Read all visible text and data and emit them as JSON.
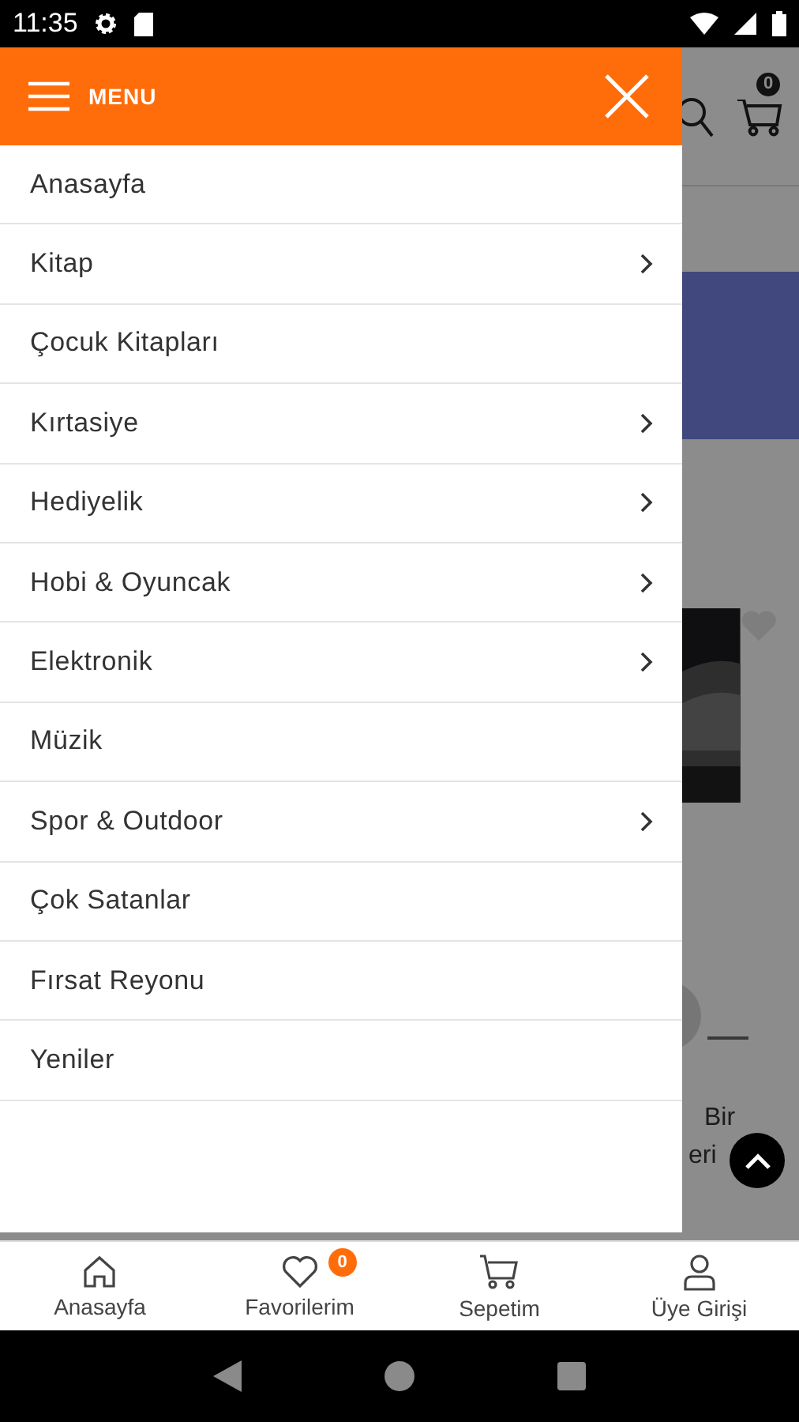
{
  "status_bar": {
    "time": "11:35"
  },
  "menu": {
    "title": "MENU",
    "items": [
      {
        "label": "Anasayfa",
        "has_submenu": false
      },
      {
        "label": "Kitap",
        "has_submenu": true
      },
      {
        "label": "Çocuk Kitapları",
        "has_submenu": false
      },
      {
        "label": "Kırtasiye",
        "has_submenu": true
      },
      {
        "label": "Hediyelik",
        "has_submenu": true
      },
      {
        "label": "Hobi & Oyuncak",
        "has_submenu": true
      },
      {
        "label": "Elektronik",
        "has_submenu": true
      },
      {
        "label": "Müzik",
        "has_submenu": false
      },
      {
        "label": "Spor & Outdoor",
        "has_submenu": true
      },
      {
        "label": "Çok Satanlar",
        "has_submenu": false
      },
      {
        "label": "Fırsat Reyonu",
        "has_submenu": false
      },
      {
        "label": "Yeniler",
        "has_submenu": false
      }
    ]
  },
  "background_page": {
    "cart_badge": "0",
    "product_title_lines": [
      "Bir",
      "eri"
    ]
  },
  "bottom_nav": [
    {
      "label": "Anasayfa",
      "kind": "home"
    },
    {
      "label": "Favorilerim",
      "kind": "favorites",
      "badge": "0"
    },
    {
      "label": "Sepetim",
      "kind": "cart"
    },
    {
      "label": "Üye Girişi",
      "kind": "account"
    }
  ]
}
